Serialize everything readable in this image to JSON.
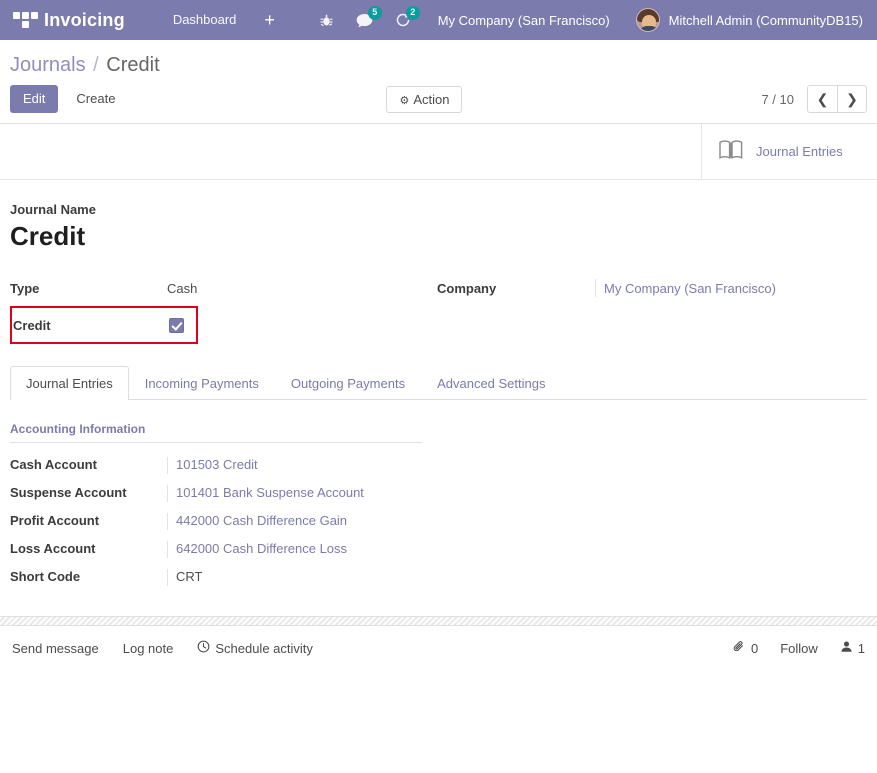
{
  "topbar": {
    "apps_icon": "apps-grid-icon",
    "brand": "Invoicing",
    "menus": [
      "Dashboard"
    ],
    "plus_label": "+",
    "icons": [
      {
        "name": "bug-icon",
        "badge": ""
      },
      {
        "name": "messages-icon",
        "badge": "5"
      },
      {
        "name": "activities-icon",
        "badge": "2"
      }
    ],
    "company": "My Company (San Francisco)",
    "user": "Mitchell Admin (CommunityDB15)"
  },
  "breadcrumb": {
    "parent": "Journals",
    "separator": "/",
    "current": "Credit"
  },
  "control_panel": {
    "edit_label": "Edit",
    "create_label": "Create",
    "action_label": "Action",
    "gear_icon": "gear-icon",
    "pager_text": "7 / 10",
    "prev_icon": "chevron-left-icon",
    "next_icon": "chevron-right-icon"
  },
  "stat_buttons": [
    {
      "icon": "journal-book-icon",
      "label": "Journal Entries"
    }
  ],
  "form": {
    "journal_name_label": "Journal Name",
    "journal_name_value": "Credit",
    "type_label": "Type",
    "type_value": "Cash",
    "credit_label": "Credit",
    "credit_checked": true,
    "company_label": "Company",
    "company_value": "My Company (San Francisco)"
  },
  "notebook": {
    "tabs": [
      {
        "label": "Journal Entries",
        "active": true
      },
      {
        "label": "Incoming Payments",
        "active": false
      },
      {
        "label": "Outgoing Payments",
        "active": false
      },
      {
        "label": "Advanced Settings",
        "active": false
      }
    ],
    "group_title": "Accounting Information",
    "rows": [
      {
        "label": "Cash Account",
        "value": "101503 Credit",
        "link": true
      },
      {
        "label": "Suspense Account",
        "value": "101401 Bank Suspense Account",
        "link": true
      },
      {
        "label": "Profit Account",
        "value": "442000 Cash Difference Gain",
        "link": true
      },
      {
        "label": "Loss Account",
        "value": "642000 Cash Difference Loss",
        "link": true
      },
      {
        "label": "Short Code",
        "value": "CRT",
        "link": false
      }
    ]
  },
  "chatter": {
    "send_message": "Send message",
    "log_note": "Log note",
    "schedule_activity": "Schedule activity",
    "schedule_icon": "clock-icon",
    "attachment_icon": "paperclip-icon",
    "attachment_count": "0",
    "follow_label": "Follow",
    "followers_icon": "user-icon",
    "followers_count": "1"
  },
  "colors": {
    "brand_purple": "#7c7bad",
    "badge_teal": "#00a09d",
    "highlight_red": "#e0001b"
  }
}
